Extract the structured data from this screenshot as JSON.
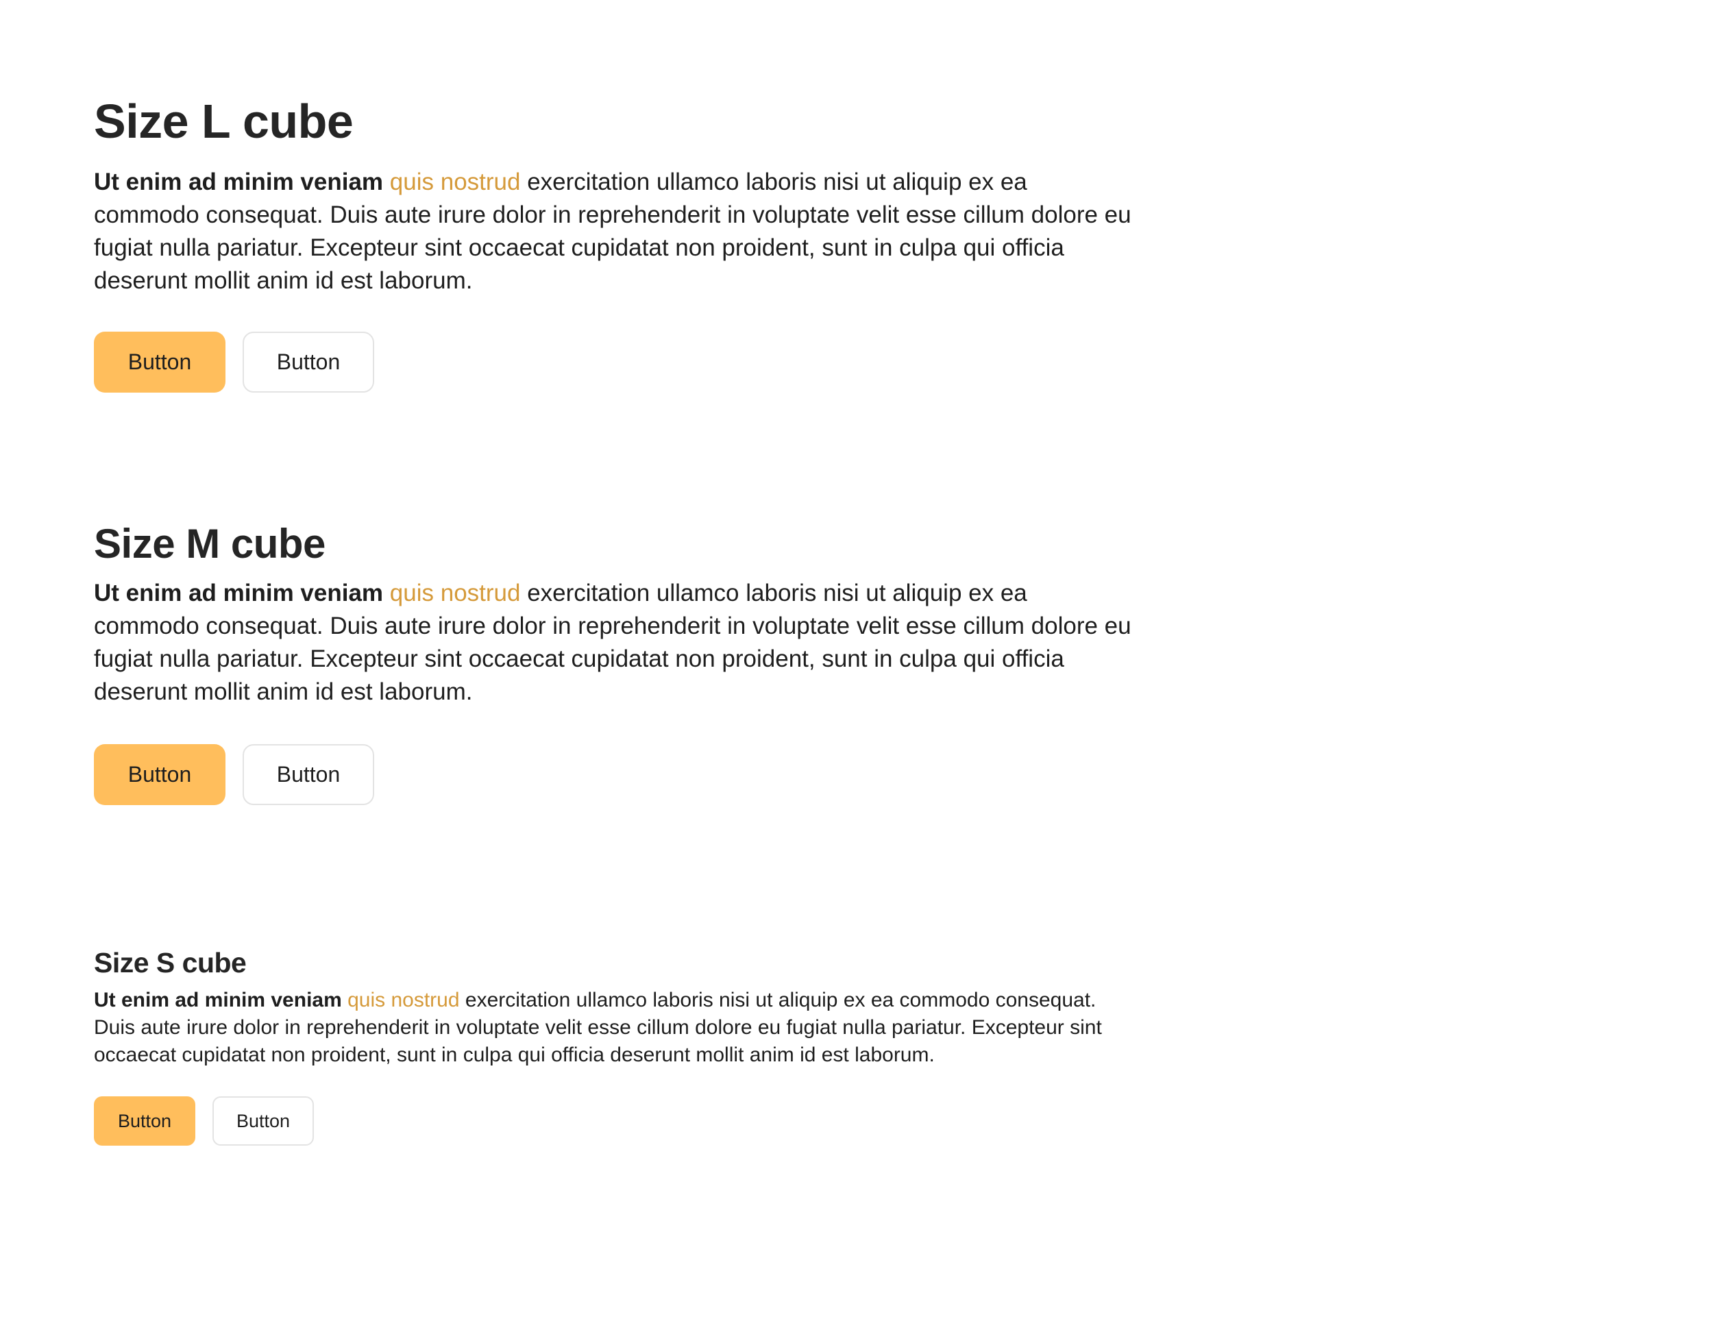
{
  "colors": {
    "accent": "#FFBE5C",
    "link": "#D59A3A",
    "text": "#1E1E1E",
    "secondary_border": "#E3E3E3",
    "background": "#FFFFFF"
  },
  "cubes": [
    {
      "size": "L",
      "title": "Size L cube",
      "bold_text": "Ut enim ad minim veniam",
      "link_text": "quis nostrud",
      "body_text": "exercitation ullamco laboris nisi ut aliquip ex ea commodo consequat. Duis aute irure dolor in reprehenderit in voluptate velit esse cillum dolore eu fugiat nulla pariatur. Excepteur sint occaecat cupidatat non proident, sunt in culpa qui officia deserunt mollit anim id est laborum.",
      "primary_button": "Button",
      "secondary_button": "Button"
    },
    {
      "size": "M",
      "title": "Size M cube",
      "bold_text": "Ut enim ad minim veniam",
      "link_text": "quis nostrud",
      "body_text": "exercitation ullamco laboris nisi ut aliquip ex ea commodo consequat. Duis aute irure dolor in reprehenderit in voluptate velit esse cillum dolore eu fugiat nulla pariatur. Excepteur sint occaecat cupidatat non proident, sunt in culpa qui officia deserunt mollit anim id est laborum.",
      "primary_button": "Button",
      "secondary_button": "Button"
    },
    {
      "size": "S",
      "title": "Size S cube",
      "bold_text": "Ut enim ad minim veniam",
      "link_text": "quis nostrud",
      "body_text": "exercitation ullamco laboris nisi ut aliquip ex ea commodo consequat. Duis aute irure dolor in reprehenderit in voluptate velit esse cillum dolore eu fugiat nulla pariatur. Excepteur sint occaecat cupidatat non proident, sunt in culpa qui officia deserunt mollit anim id est laborum.",
      "primary_button": "Button",
      "secondary_button": "Button"
    }
  ]
}
